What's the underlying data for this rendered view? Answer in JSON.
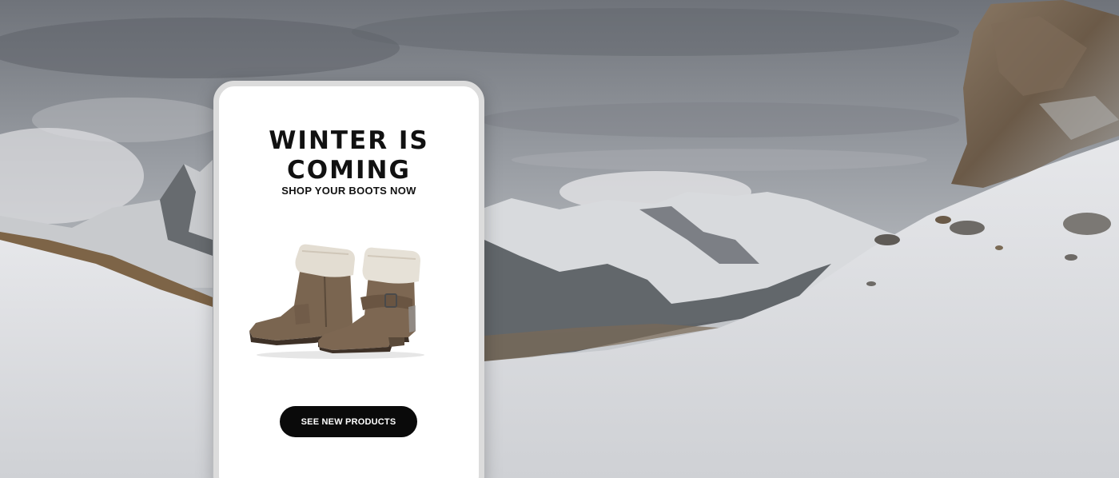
{
  "banner": {
    "headline_line1": "WINTER IS",
    "headline_line2": "COMING",
    "subheadline": "SHOP YOUR BOOTS NOW",
    "cta_label": "SEE NEW PRODUCTS"
  },
  "colors": {
    "card_background": "#ffffff",
    "card_border": "#dcdcdc",
    "cta_background": "#0a0a0a",
    "cta_text": "#ffffff",
    "headline_text": "#111111"
  },
  "icons": {
    "product_image": "ankle-boots-with-fur-cuff"
  }
}
